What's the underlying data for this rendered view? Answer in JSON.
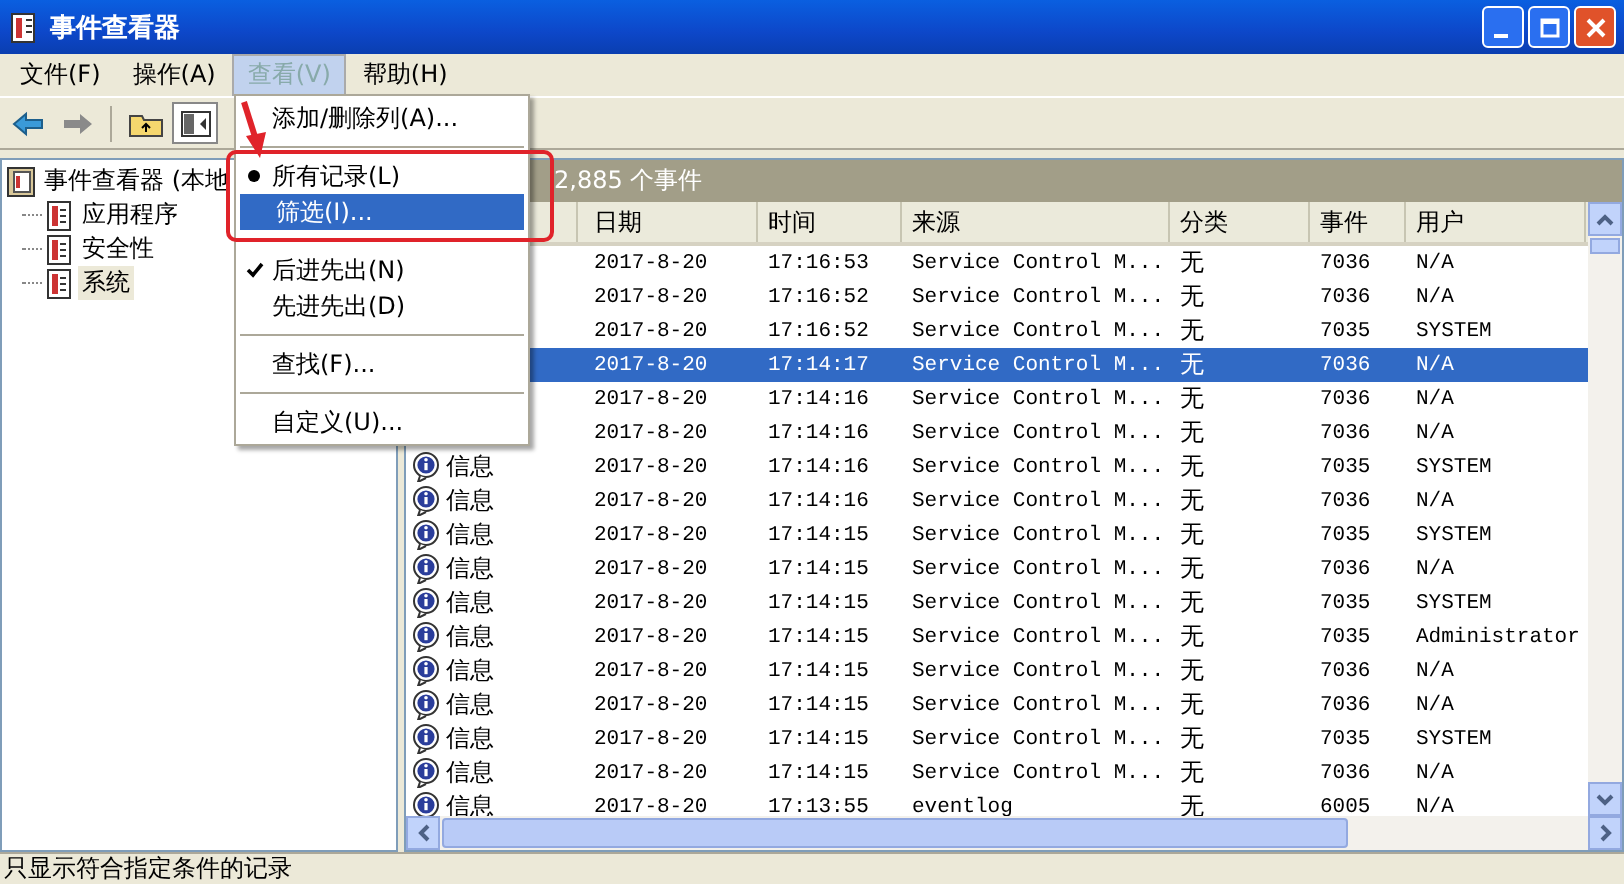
{
  "window": {
    "title": "事件查看器"
  },
  "menu_bar": [
    {
      "label": "文件(F)",
      "selected": false
    },
    {
      "label": "操作(A)",
      "selected": false
    },
    {
      "label": "查看(V)",
      "selected": true
    },
    {
      "label": "帮助(H)",
      "selected": false
    }
  ],
  "view_menu": [
    {
      "kind": "command",
      "label": "添加/删除列(A)...",
      "selected": false
    },
    {
      "kind": "separator"
    },
    {
      "kind": "radio",
      "label": "所有记录(L)",
      "checked": true,
      "selected": false
    },
    {
      "kind": "command",
      "label": "筛选(I)...",
      "selected": true
    },
    {
      "kind": "separator"
    },
    {
      "kind": "check",
      "label": "后进先出(N)",
      "checked": true,
      "selected": false
    },
    {
      "kind": "check",
      "label": "先进先出(D)",
      "checked": false,
      "selected": false
    },
    {
      "kind": "separator"
    },
    {
      "kind": "command",
      "label": "查找(F)...",
      "selected": false
    },
    {
      "kind": "separator"
    },
    {
      "kind": "command",
      "label": "自定义(U)...",
      "selected": false
    }
  ],
  "tree": {
    "label": "事件查看器 (本地",
    "children": [
      {
        "label": "应用程序",
        "selected": false
      },
      {
        "label": "安全性",
        "selected": false
      },
      {
        "label": "系统",
        "selected": true
      }
    ]
  },
  "pane_header": "2,885 个事件",
  "table": {
    "columns": [
      "日期",
      "时间",
      "来源",
      "分类",
      "事件",
      "用户"
    ],
    "rows": [
      {
        "date": "2017-8-20",
        "time": "17:16:53",
        "source": "Service Control M...",
        "category": "无",
        "event": "7036",
        "user": "N/A",
        "selected": false
      },
      {
        "date": "2017-8-20",
        "time": "17:16:52",
        "source": "Service Control M...",
        "category": "无",
        "event": "7036",
        "user": "N/A",
        "selected": false
      },
      {
        "date": "2017-8-20",
        "time": "17:16:52",
        "source": "Service Control M...",
        "category": "无",
        "event": "7035",
        "user": "SYSTEM",
        "selected": false
      },
      {
        "date": "2017-8-20",
        "time": "17:14:17",
        "source": "Service Control M...",
        "category": "无",
        "event": "7036",
        "user": "N/A",
        "selected": true
      },
      {
        "date": "2017-8-20",
        "time": "17:14:16",
        "source": "Service Control M...",
        "category": "无",
        "event": "7036",
        "user": "N/A",
        "selected": false
      },
      {
        "date": "2017-8-20",
        "time": "17:14:16",
        "source": "Service Control M...",
        "category": "无",
        "event": "7036",
        "user": "N/A",
        "selected": false
      },
      {
        "type": "信息",
        "date": "2017-8-20",
        "time": "17:14:16",
        "source": "Service Control M...",
        "category": "无",
        "event": "7035",
        "user": "SYSTEM",
        "selected": false
      },
      {
        "type": "信息",
        "date": "2017-8-20",
        "time": "17:14:16",
        "source": "Service Control M...",
        "category": "无",
        "event": "7036",
        "user": "N/A",
        "selected": false
      },
      {
        "type": "信息",
        "date": "2017-8-20",
        "time": "17:14:15",
        "source": "Service Control M...",
        "category": "无",
        "event": "7035",
        "user": "SYSTEM",
        "selected": false
      },
      {
        "type": "信息",
        "date": "2017-8-20",
        "time": "17:14:15",
        "source": "Service Control M...",
        "category": "无",
        "event": "7036",
        "user": "N/A",
        "selected": false
      },
      {
        "type": "信息",
        "date": "2017-8-20",
        "time": "17:14:15",
        "source": "Service Control M...",
        "category": "无",
        "event": "7035",
        "user": "SYSTEM",
        "selected": false
      },
      {
        "type": "信息",
        "date": "2017-8-20",
        "time": "17:14:15",
        "source": "Service Control M...",
        "category": "无",
        "event": "7035",
        "user": "Administrator",
        "selected": false
      },
      {
        "type": "信息",
        "date": "2017-8-20",
        "time": "17:14:15",
        "source": "Service Control M...",
        "category": "无",
        "event": "7036",
        "user": "N/A",
        "selected": false
      },
      {
        "type": "信息",
        "date": "2017-8-20",
        "time": "17:14:15",
        "source": "Service Control M...",
        "category": "无",
        "event": "7036",
        "user": "N/A",
        "selected": false
      },
      {
        "type": "信息",
        "date": "2017-8-20",
        "time": "17:14:15",
        "source": "Service Control M...",
        "category": "无",
        "event": "7035",
        "user": "SYSTEM",
        "selected": false
      },
      {
        "type": "信息",
        "date": "2017-8-20",
        "time": "17:14:15",
        "source": "Service Control M...",
        "category": "无",
        "event": "7036",
        "user": "N/A",
        "selected": false
      },
      {
        "type": "信息",
        "date": "2017-8-20",
        "time": "17:13:55",
        "source": "eventlog",
        "category": "无",
        "event": "6005",
        "user": "N/A",
        "selected": false
      }
    ]
  },
  "status_bar": "只显示符合指定条件的记录"
}
